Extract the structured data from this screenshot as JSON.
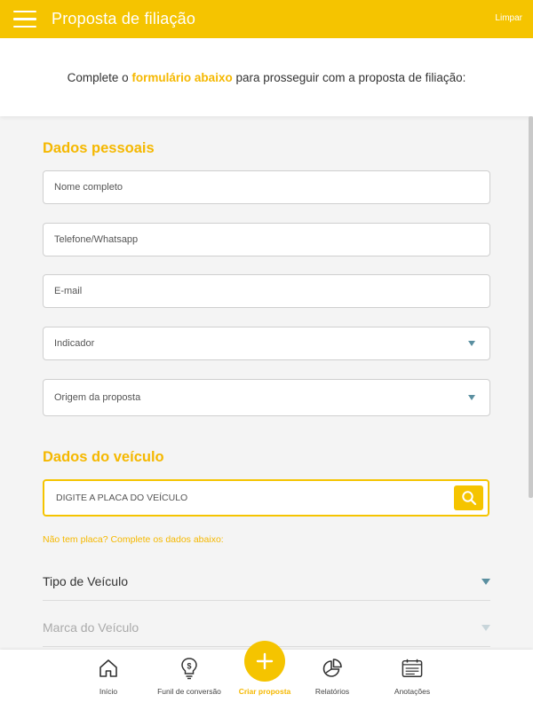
{
  "header": {
    "title": "Proposta de filiação",
    "action_label": "Limpar"
  },
  "intro": {
    "before": "Complete o ",
    "highlight": "formulário abaixo",
    "after": " para prosseguir com a proposta de filiação:"
  },
  "personal": {
    "title": "Dados pessoais",
    "fields": {
      "name": "Nome completo",
      "phone": "Telefone/Whatsapp",
      "email": "E-mail",
      "indicator": "Indicador",
      "origin": "Origem da proposta"
    }
  },
  "vehicle": {
    "title": "Dados do veículo",
    "plate_placeholder": "DIGITE A PLACA DO VEÍCULO",
    "no_plate_text": "Não tem placa? Complete os dados abaixo:",
    "type_label": "Tipo de Veículo",
    "brand_label": "Marca do Veículo"
  },
  "bottom_nav": {
    "home": "Início",
    "funnel": "Funil de conversão",
    "create": "Criar proposta",
    "reports": "Relatórios",
    "notes": "Anotações"
  },
  "colors": {
    "accent": "#f5c400",
    "accent_text": "#f5b800",
    "caret": "#5a8fa0"
  }
}
